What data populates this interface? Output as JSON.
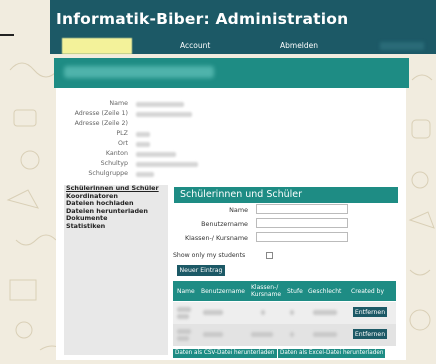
{
  "header": {
    "title": "Informatik-Biber: Administration"
  },
  "nav": {
    "account": "Account",
    "logout": "Abmelden"
  },
  "info_labels": [
    "Name",
    "Adresse (Zeile 1)",
    "Adresse (Zeile 2)",
    "PLZ",
    "Ort",
    "Kanton",
    "Schultyp",
    "Schulgruppe"
  ],
  "menu": {
    "items": [
      "Schülerinnen und Schüler",
      "Koordinatoren",
      "Dateien hochladen",
      "Dateien herunterladen",
      "Dokumente",
      "Statistiken"
    ]
  },
  "section": {
    "title": "Schülerinnen und Schüler",
    "name_label": "Name",
    "username_label": "Benutzername",
    "class_label": "Klassen-/ Kursname",
    "show_only_mine": "Show only my students",
    "new_entry": "Neuer Eintrag"
  },
  "table": {
    "headers": [
      "Name",
      "Benutzername",
      "Klassen-/ Kursname",
      "Stufe",
      "Geschlecht",
      "Created by"
    ],
    "remove_label": "Entfernen"
  },
  "downloads": {
    "csv": "Daten als CSV-Datei herunterladen",
    "excel": "Daten als Excel-Datei herunterladen"
  },
  "colors": {
    "header": "#1c5966",
    "accent": "#1e8c84",
    "background": "#f1ecdf"
  }
}
